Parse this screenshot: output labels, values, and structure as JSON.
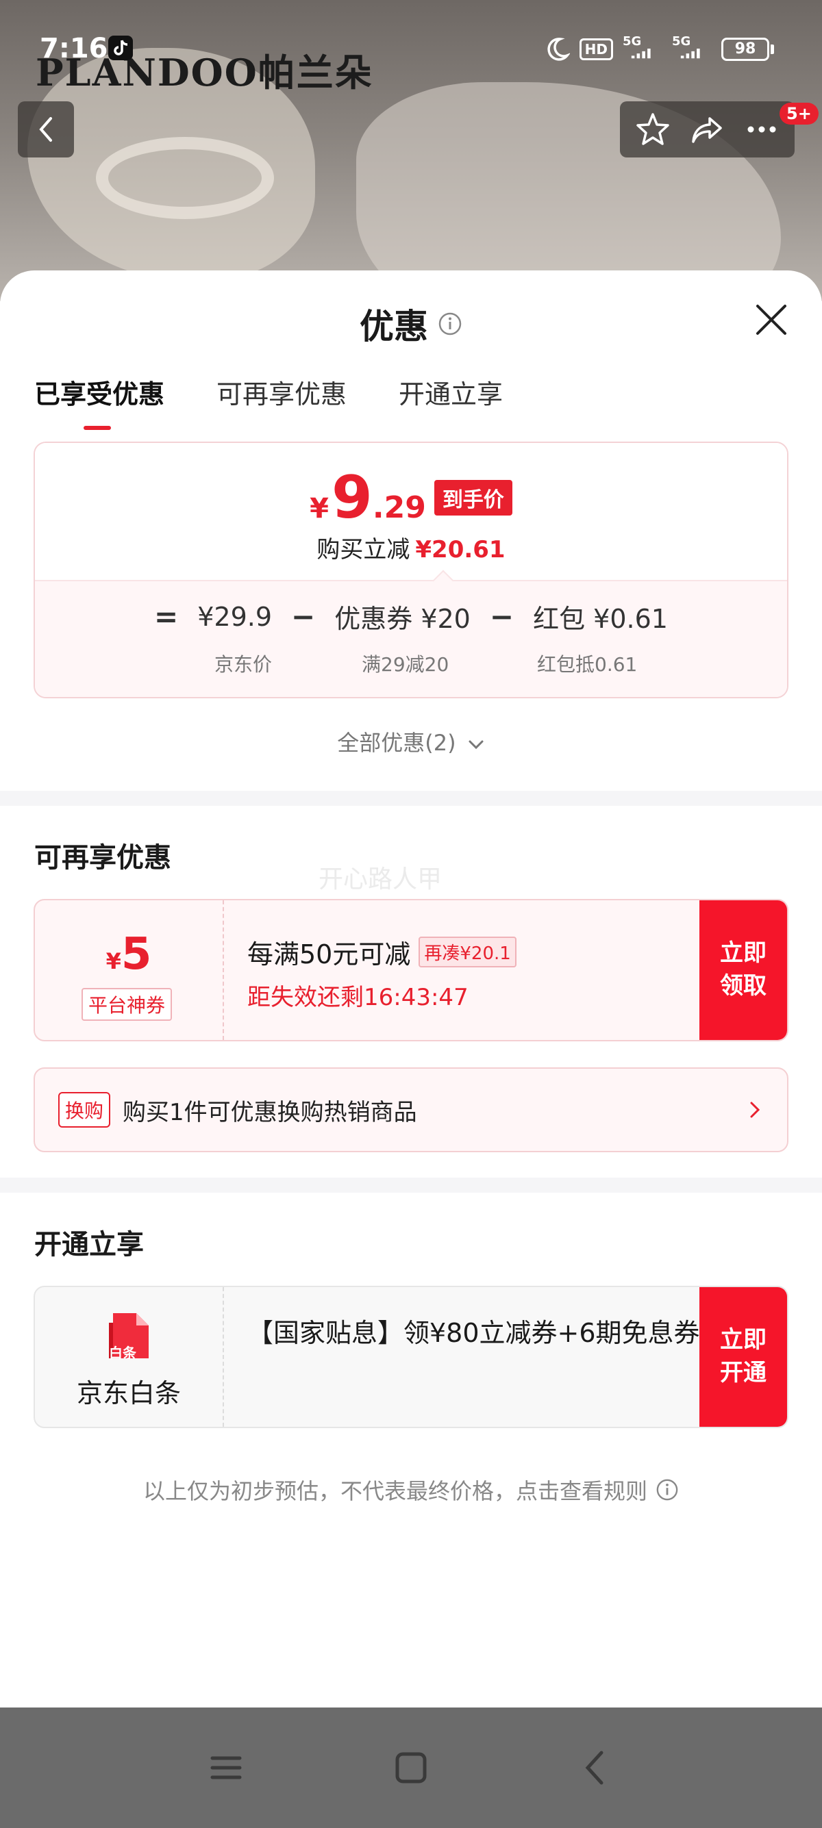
{
  "status_bar": {
    "time": "7:16",
    "network_badge": "HD",
    "signal_label_1": "5G",
    "signal_label_2": "5G",
    "battery": "98"
  },
  "background": {
    "brand": "PLANDOO帕兰朵"
  },
  "header": {
    "message_badge": "5+"
  },
  "sheet": {
    "title": "优惠",
    "tabs": [
      {
        "label": "已享受优惠",
        "active": true
      },
      {
        "label": "可再享优惠",
        "active": false
      },
      {
        "label": "开通立享",
        "active": false
      }
    ]
  },
  "price_card": {
    "currency": "¥",
    "price_int": "9",
    "price_dec": ".29",
    "price_tag": "到手价",
    "reduce_label": "购买立减",
    "reduce_value": "¥20.61",
    "formula": {
      "eq": "=",
      "jd_price": "¥29.9",
      "minus1": "−",
      "coupon": "优惠券 ¥20",
      "minus2": "−",
      "redpacket": "红包 ¥0.61",
      "jd_price_label": "京东价",
      "coupon_label": "满29减20",
      "redpacket_label": "红包抵0.61"
    },
    "all_discounts": "全部优惠(2)"
  },
  "more_section": {
    "title": "可再享优惠",
    "watermark": "开心路人甲",
    "coupon": {
      "currency": "¥",
      "amount": "5",
      "type": "平台神券",
      "main": "每满50元可减",
      "tag": "再凑¥20.1",
      "sub": "距失效还剩16:43:47",
      "button_line1": "立即",
      "button_line2": "领取"
    },
    "exchange": {
      "tag": "换购",
      "text": "购买1件可优惠换购热销商品"
    }
  },
  "open_section": {
    "title": "开通立享",
    "card": {
      "logo_text": "白条",
      "name": "京东白条",
      "desc": "【国家贴息】领¥80立减券+6期免息券",
      "button_line1": "立即",
      "button_line2": "开通"
    }
  },
  "disclaimer": "以上仅为初步预估，不代表最终价格，点击查看规则",
  "colors": {
    "accent": "#e8202e",
    "button": "#f5152a"
  }
}
